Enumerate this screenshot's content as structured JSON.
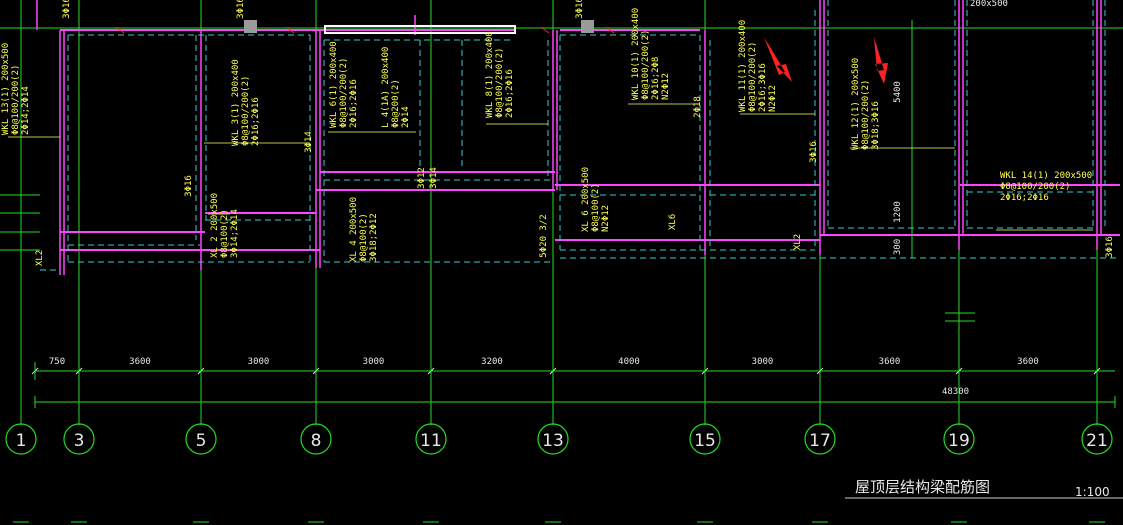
{
  "drawing": {
    "title": "屋顶层结构梁配筋图",
    "scale": "1:100"
  },
  "axes": [
    {
      "label": "1"
    },
    {
      "label": "3"
    },
    {
      "label": "5"
    },
    {
      "label": "8"
    },
    {
      "label": "11"
    },
    {
      "label": "13"
    },
    {
      "label": "15"
    },
    {
      "label": "17"
    },
    {
      "label": "19"
    },
    {
      "label": "21"
    }
  ],
  "dimensions": {
    "spans": [
      "750",
      "3600",
      "3000",
      "3000",
      "3200",
      "4000",
      "3000",
      "3600",
      "3600"
    ],
    "total": "48300",
    "vertical": [
      "5400",
      "1200",
      "300"
    ],
    "top_right": "200x500"
  },
  "beam_labels": [
    {
      "lines": [
        "WKL 13(1) 200x500",
        "Φ8@100/200(2)",
        "2Φ14;2Φ14"
      ]
    },
    {
      "lines": [
        "WKL 3(1) 200x400",
        "Φ8@100/200(2)",
        "2Φ16;2Φ16"
      ]
    },
    {
      "lines": [
        "WKL 6(1) 200x400",
        "Φ8@100/200(2)",
        "2Φ16;2Φ16"
      ]
    },
    {
      "lines": [
        "L 4(1A) 200x400",
        "Φ8@200(2)",
        "2Φ14"
      ]
    },
    {
      "lines": [
        "WKL 8(1) 200x400",
        "Φ8@100/200(2)",
        "2Φ16;2Φ16"
      ]
    },
    {
      "lines": [
        "WKL 10(1) 200x400",
        "Φ8@100/200(2)",
        "2Φ16;2Φ8",
        "N2Φ12"
      ]
    },
    {
      "lines": [
        "WKL 11(1) 200x400",
        "Φ8@100/200(2)",
        "2Φ16;3Φ16",
        "N2Φ12"
      ]
    },
    {
      "lines": [
        "WKL 12(1) 200x500",
        "Φ8@100/200(2)",
        "3Φ18;3Φ16"
      ]
    },
    {
      "lines": [
        "WKL 14(1) 200x500",
        "Φ8@100/200(2)",
        "2Φ16;2Φ16"
      ]
    },
    {
      "lines": [
        "XL 2 200x500",
        "Φ8@100(2)",
        "3Φ14;2Φ14"
      ]
    },
    {
      "lines": [
        "XL 4 200x500",
        "Φ8@100(2)",
        "3Φ18;2Φ12"
      ]
    },
    {
      "lines": [
        "XL 6 200x500",
        "Φ8@100(2)",
        "N2Φ12"
      ]
    }
  ],
  "bar_callouts": [
    "3Φ16",
    "3Φ16",
    "3Φ16",
    "3Φ14",
    "3Φ16",
    "5Φ20 3/2",
    "2Φ18",
    "3Φ16",
    "3Φ16",
    "3Φ12",
    "3Φ14"
  ],
  "tags": [
    "XL2",
    "XL6",
    "XL2"
  ],
  "colors": {
    "background": "#000000",
    "beam": "#ff44ff",
    "dashed": "#33cccc",
    "axis": "#22dd22",
    "text": "#ffff55",
    "annotation": "#ff2222"
  }
}
